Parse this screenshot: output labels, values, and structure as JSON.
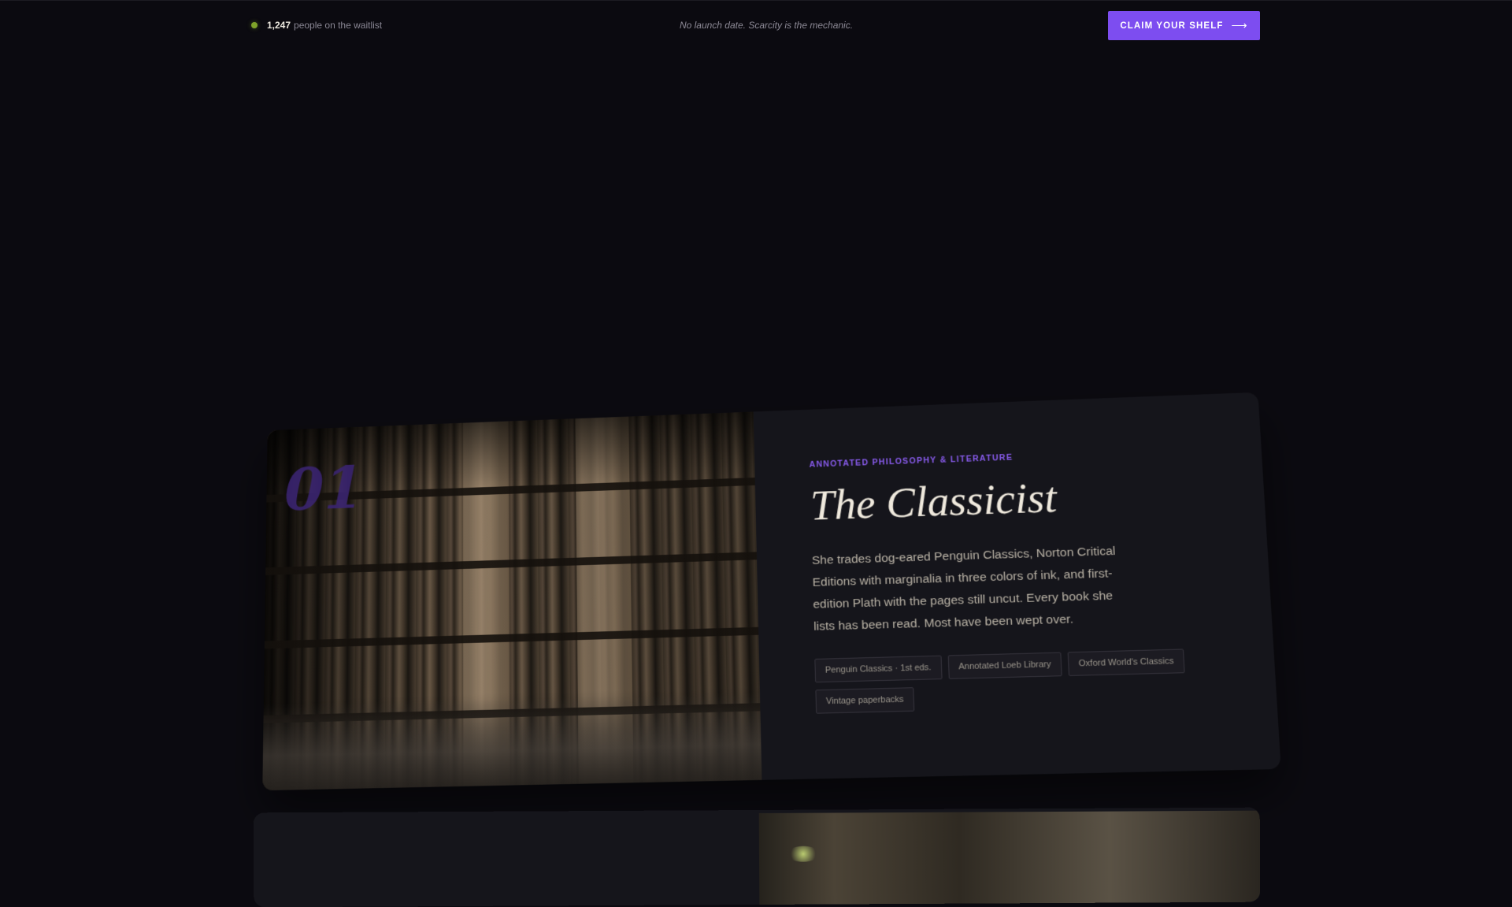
{
  "topbar": {
    "waitlist_count": "1,247",
    "waitlist_label": "people on the waitlist",
    "tagline": "No launch date. Scarcity is the mechanic.",
    "cta_label": "CLAIM YOUR SHELF",
    "cta_arrow": "⟶"
  },
  "cards": [
    {
      "number": "01",
      "eyebrow": "ANNOTATED PHILOSOPHY & LITERATURE",
      "title": "The Classicist",
      "description": "She trades dog-eared Penguin Classics, Norton Critical Editions with marginalia in three colors of ink, and first-edition Plath with the pages still uncut. Every book she lists has been read. Most have been wept over.",
      "tags": [
        "Penguin Classics · 1st eds.",
        "Annotated Loeb Library",
        "Oxford World's Classics",
        "Vintage paperbacks"
      ]
    }
  ],
  "colors": {
    "background": "#0b0a10",
    "accent": "#7d4df0",
    "status_dot": "#7fa32a",
    "card": "#15151b"
  }
}
